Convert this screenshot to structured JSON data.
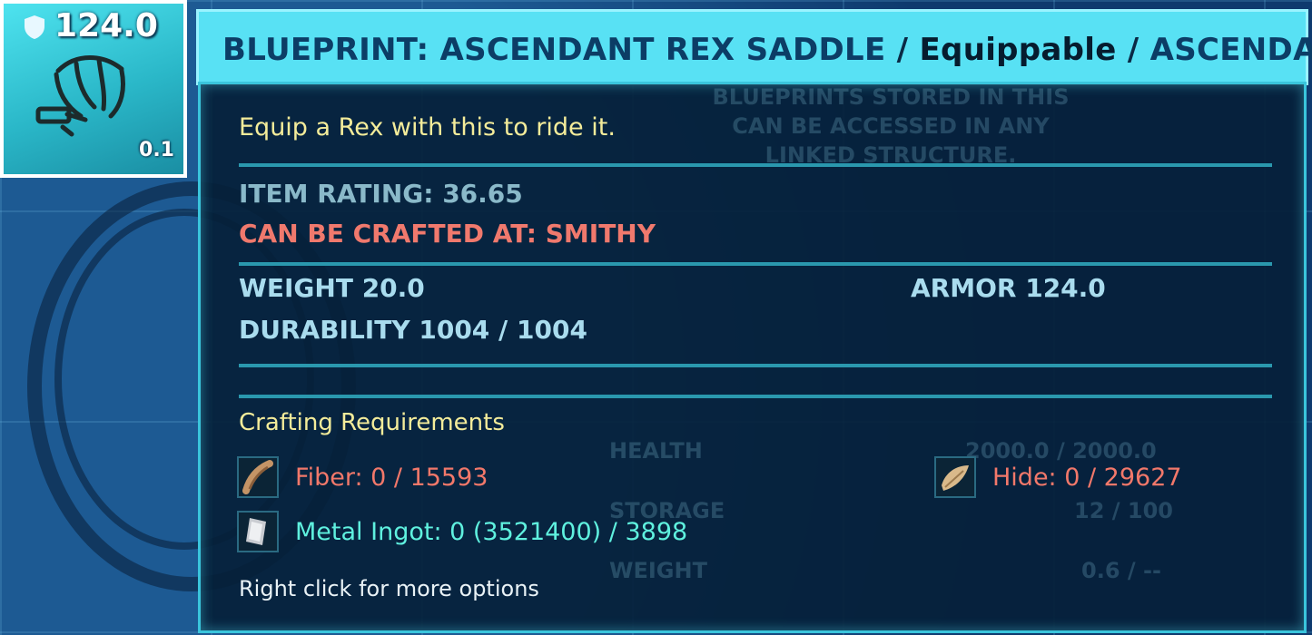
{
  "slot": {
    "armor_value": "124.0",
    "weight_value": "0.1",
    "icon": "saddle-icon",
    "badge_icon": "shield-icon"
  },
  "tooltip": {
    "title_name": "BLUEPRINT: ASCENDANT REX SADDLE",
    "title_sep1": " / ",
    "title_type": "Equippable",
    "title_sep2": " / ",
    "title_quality": "ASCENDANT",
    "description": "Equip a Rex with this to ride it.",
    "item_rating": "ITEM RATING: 36.65",
    "crafted_at": "CAN BE CRAFTED AT: SMITHY",
    "weight": "WEIGHT 20.0",
    "armor": "ARMOR 124.0",
    "durability": "DURABILITY 1004 / 1004",
    "requirements_title": "Crafting Requirements",
    "requirements": [
      {
        "label": "Fiber: 0 / 15593",
        "icon": "fiber-icon",
        "status_color": "#f2786a"
      },
      {
        "label": "Hide: 0 / 29627",
        "icon": "hide-icon",
        "status_color": "#f2786a"
      },
      {
        "label": "Metal Ingot: 0 (3521400) / 3898",
        "icon": "metal-ingot-icon",
        "status_color": "#5ff1df"
      }
    ],
    "hint": "Right click for more options"
  },
  "background_ghost": {
    "blueprint_note_line1": "BLUEPRINTS STORED IN THIS",
    "blueprint_note_line2": "CAN BE ACCESSED IN ANY",
    "blueprint_note_line3": "LINKED STRUCTURE.",
    "health_label": "HEALTH",
    "health_value": "2000.0 / 2000.0",
    "storage_label": "STORAGE",
    "storage_value": "12 / 100",
    "weight_label": "WEIGHT",
    "weight_value": "0.6 / --"
  },
  "colors": {
    "title_bg": "#58e1f4",
    "panel_border": "#3ac5dc",
    "description": "#f4ec9a",
    "danger": "#f2786a",
    "ok": "#5ff1df"
  }
}
